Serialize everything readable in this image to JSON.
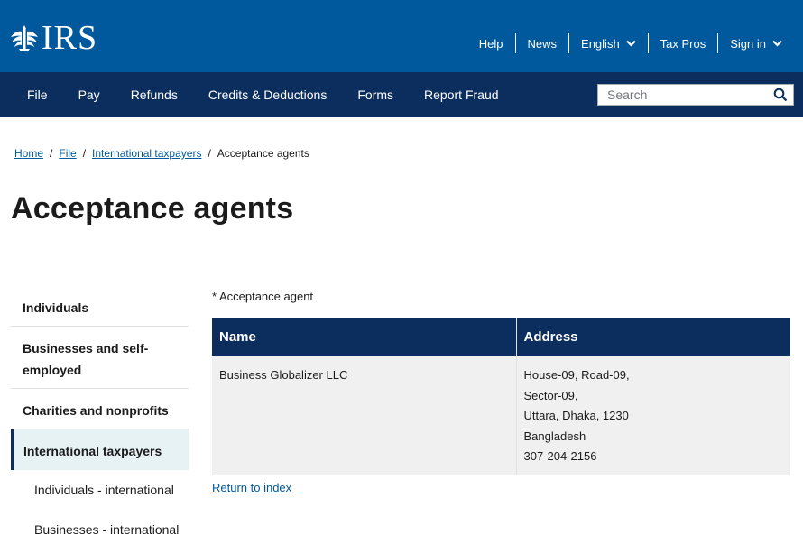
{
  "header": {
    "logo_text": "IRS",
    "utility_links": [
      "Help",
      "News"
    ],
    "language_label": "English",
    "tax_pros_label": "Tax Pros",
    "sign_in_label": "Sign in"
  },
  "nav": {
    "items": [
      "File",
      "Pay",
      "Refunds",
      "Credits & Deductions",
      "Forms",
      "Report Fraud"
    ],
    "search_placeholder": "Search"
  },
  "breadcrumb": {
    "items": [
      "Home",
      "File",
      "International taxpayers"
    ],
    "separator": "/",
    "current": "Acceptance agents"
  },
  "page": {
    "title": "Acceptance agents",
    "note": "* Acceptance agent"
  },
  "sidebar": {
    "items": [
      "Individuals",
      "Businesses and self-employed",
      "Charities and nonprofits",
      "International taxpayers"
    ],
    "active_index": 3,
    "sub_items": [
      "Individuals - international",
      "Businesses - international"
    ]
  },
  "table": {
    "headers": [
      "Name",
      "Address"
    ],
    "rows": [
      {
        "name": "Business Globalizer LLC",
        "address_lines": [
          "House-09, Road-09,",
          "Sector-09,",
          "Uttara, Dhaka, 1230",
          "Bangladesh",
          "307-204-2156"
        ]
      }
    ]
  },
  "return_link": "Return to index",
  "colors": {
    "header_blue": "#00599c",
    "nav_navy": "#0b2e5e",
    "link_blue": "#00599c",
    "active_bg": "#e7f2f5",
    "row_bg": "#f0f0f0"
  }
}
